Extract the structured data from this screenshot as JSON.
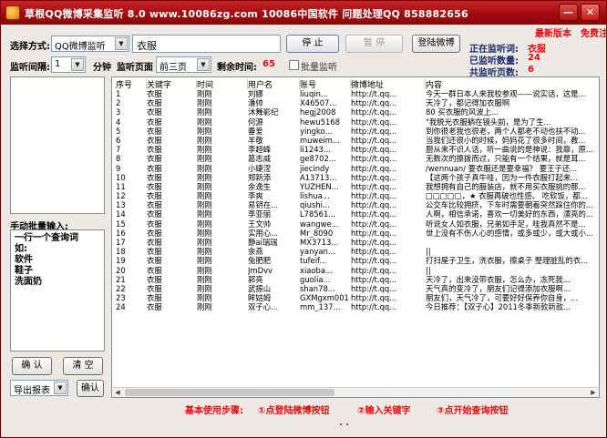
{
  "window": {
    "title": "草根QQ微博采集监听 8.0    www.10086zg.com    10086中国软件    问题处理QQ 858882656",
    "minimize": "—",
    "close": "✕"
  },
  "header": {
    "mode_label": "选择方式:",
    "mode_value": "QQ微博监听",
    "keyword_value": "衣服",
    "stop_button": "停 止",
    "pause_button": "暂 停",
    "login_button": "登陆微博",
    "latest_version": "最新版本",
    "free_register": "免费注册",
    "interval_label": "监听间隔:",
    "interval_value": "1",
    "minute_label": "分钟",
    "page_label": "监听页面",
    "page_value": "前三页",
    "remaining_label": "剩余时间:",
    "remaining_value": "65",
    "batch_label": "批量监听"
  },
  "status": {
    "monitoring_label": "正在监听词:",
    "monitoring_value": "衣服",
    "count_label": "已监听数量:",
    "count_value": "24",
    "pages_label": "共监听页数:",
    "pages_value": "6"
  },
  "left": {
    "batch_title": "手动批量输入:",
    "batch_text": [
      "一行一个查询词",
      "如:",
      "软件",
      "鞋子",
      "洗面奶"
    ],
    "confirm_button": "确 认",
    "clear_button": "清 空",
    "export_label": "导出报表",
    "export_confirm": "确认"
  },
  "table": {
    "columns": [
      "序号",
      "关键字",
      "时间",
      "用户名",
      "账号",
      "微博地址",
      "内容"
    ],
    "rows": [
      [
        "1",
        "衣服",
        "刚刚",
        "刘娜",
        "liuqin...",
        "http://t.qq...",
        "今天一群日本人来我校参观——说实话，这是..."
      ],
      [
        "2",
        "衣服",
        "刚刚",
        "潘帅",
        "X46507...",
        "http://t.qq...",
        "天冷了，都记得加衣服啊"
      ],
      [
        "3",
        "衣服",
        "刚刚",
        "沐舞影纪",
        "hegj2008",
        "http://t.qq...",
        "80 买衣服的风波上..."
      ],
      [
        "4",
        "衣服",
        "刚刚",
        "何源",
        "hewu5168",
        "http://t.qq...",
        "\"我脱光衣服躺在镜头前，是为了生..."
      ],
      [
        "5",
        "衣服",
        "刚刚",
        "垂爱",
        "yingko...",
        "http://t.qq...",
        "到你很老我也很老，两个人都老不动也扶不动..."
      ],
      [
        "6",
        "衣服",
        "刚刚",
        "羊敬",
        "muweim...",
        "http://t.qq...",
        "当我们还很小的时候，妈妈花了很多时间，教..."
      ],
      [
        "7",
        "衣服",
        "刚刚",
        "李超峰",
        "li1243...",
        "http://t.qq...",
        "厨从来不识人话，听一曲说的是神说：我靠，原..."
      ],
      [
        "8",
        "衣服",
        "刚刚",
        "葛志威",
        "ge8702...",
        "http://t.qq...",
        "无数次的撩拨而过，只能有一个结果，就是耳..."
      ],
      [
        "9",
        "衣服",
        "刚刚",
        "小婕涅",
        "jiecindy",
        "http://t.qq...",
        "/wennuan/ 要衣服还是要幸福？ 要王子还..."
      ],
      [
        "10",
        "衣服",
        "刚刚",
        "郑新添",
        "A13713...",
        "http://t.qq...",
        "【这两个孩子真牛哇，因为一件衣服打起来..."
      ],
      [
        "11",
        "衣服",
        "刚刚",
        "余逸生",
        "YUZHEN...",
        "http://t.qq...",
        "我想拥有自己的服装店，就不用买衣服挑的那..."
      ],
      [
        "12",
        "衣服",
        "刚刚",
        "李爽",
        "lishua...",
        "http://t.qq...",
        "□□□□□，★ 衣服再破也性感、 吃软饭，都..."
      ],
      [
        "13",
        "衣服",
        "刚刚",
        "易钥在...",
        "qiushi...",
        "http://t.qq...",
        "公交车比较拥挤，下车时需要朝着突然踩住你的..."
      ],
      [
        "14",
        "衣服",
        "刚刚",
        "李亚丽",
        "L78561...",
        "http://t.qq...",
        "人啊，相信承诺，喜欢一切美好的东西，漂亮的..."
      ],
      [
        "15",
        "衣服",
        "刚刚",
        "王文帅",
        "wangwe...",
        "http://t.qq...",
        "听说女人如衣服，兄弟如手足，哇我真然不是..."
      ],
      [
        "16",
        "衣服",
        "刚刚",
        "实用心...",
        "Mr_8090",
        "http://t.qq...",
        "世上没有不伤人心的感情，或多或少，或大或小..."
      ],
      [
        "17",
        "衣服",
        "刚刚",
        "静ai瑞瑞",
        "MX3713...",
        "http://t.qq...",
        ""
      ],
      [
        "18",
        "衣服",
        "刚刚",
        "余燕",
        "yanyan...",
        "http://t.qq...",
        "||"
      ],
      [
        "19",
        "衣服",
        "刚刚",
        "兔肥肥",
        "tufeif...",
        "http://t.qq...",
        "打扫屋子卫生，洗衣服，擦桌子 整理脏乱的衣..."
      ],
      [
        "20",
        "衣服",
        "刚刚",
        "JmDvv",
        "xiaoba...",
        "http://t.qq...",
        "||"
      ],
      [
        "21",
        "衣服",
        "刚刚",
        "郭亮",
        "guolia...",
        "http://t.qq...",
        "天冷了，出来没带衣服，怎么办，冻死我..."
      ],
      [
        "22",
        "衣服",
        "刚刚",
        "武振山",
        "shan78...",
        "http://t.qq...",
        "天气真的变冷了，朋友们记得添加衣服啊..."
      ],
      [
        "23",
        "衣服",
        "刚刚",
        "眸姑姆",
        "GXMgxm001",
        "http://t.qq...",
        "朋友们，天气冷了，可要好好保养你自身，..."
      ],
      [
        "24",
        "衣服",
        "刚刚",
        "双子心...",
        "mm_137...",
        "http://t.qq...",
        "今日推荐：【双子心】2011冬季新款新款..."
      ]
    ]
  },
  "footer": {
    "steps_label": "基本使用步骤:",
    "step1": "①点登陆微博按钮",
    "step2": "②输入关键字",
    "step3": "③点开始查询按钮",
    "dots": ". ."
  },
  "colors": {
    "title_bar": "#a00c10",
    "accent_red": "#e01010",
    "footer_red": "#d01818"
  }
}
